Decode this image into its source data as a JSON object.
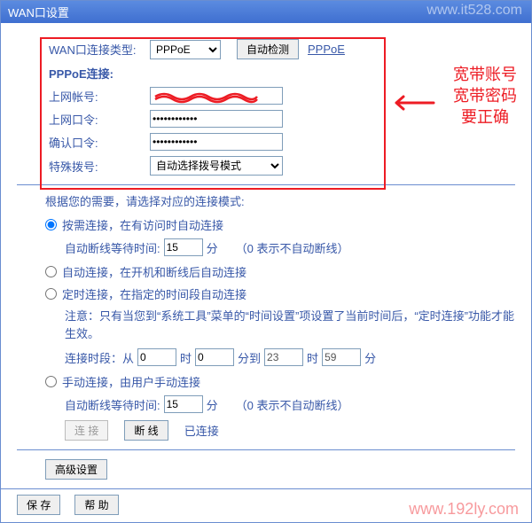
{
  "title": "WAN口设置",
  "watermark_top": "www.it528.com",
  "watermark_bot": "www.192ly.com",
  "labels": {
    "conn_type": "WAN口连接类型:",
    "pppoe": "PPPoE连接:",
    "user": "上网帐号:",
    "pass": "上网口令:",
    "confirm": "确认口令:",
    "special": "特殊拨号:"
  },
  "conn_type_options": [
    "PPPoE"
  ],
  "auto_detect": "自动检测",
  "pppoe_link": "PPPoE",
  "dial_mode": "自动选择拨号模式",
  "annot_lines": [
    "宽带账号",
    "宽带密码",
    "要正确"
  ],
  "mode_prompt": "根据您的需要，请选择对应的连接模式:",
  "modes": {
    "on_demand": "按需连接，在有访问时自动连接",
    "auto": "自动连接，在开机和断线后自动连接",
    "time": "定时连接，在指定的时间段自动连接",
    "manual": "手动连接，由用户手动连接"
  },
  "idle_label": "自动断线等待时间:",
  "minutes": "分",
  "idle_note": "（0 表示不自动断线）",
  "idle_value_1": "15",
  "idle_value_2": "15",
  "time_note": "注意：只有当您到“系统工具”菜单的“时间设置”项设置了当前时间后，“定时连接”功能才能生效。",
  "time_labels": {
    "period": "连接时段：从",
    "hour": "时",
    "min_to": "分到",
    "min": "分"
  },
  "time_values": {
    "h1": "0",
    "m1": "0",
    "h2": "23",
    "m2": "59"
  },
  "buttons": {
    "connect": "连 接",
    "disconnect": "断 线",
    "status": "已连接",
    "advanced": "高级设置",
    "save": "保 存",
    "help": "帮 助"
  }
}
